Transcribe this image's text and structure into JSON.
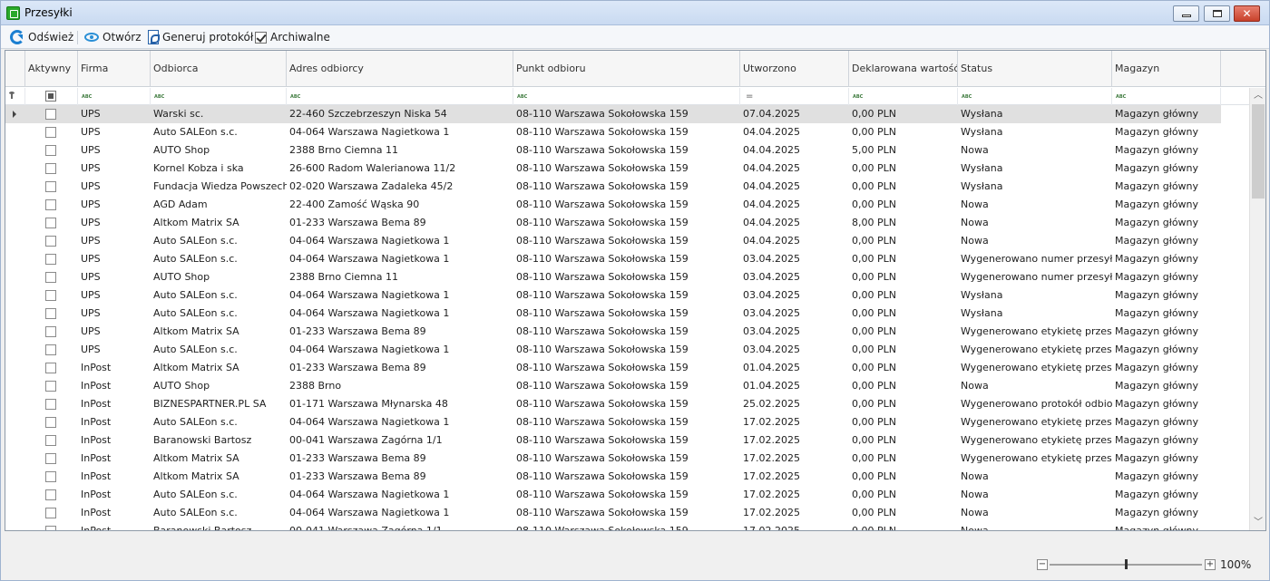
{
  "window": {
    "title": "Przesyłki"
  },
  "toolbar": {
    "refresh_label": "Odśwież",
    "open_label": "Otwórz",
    "protocol_label": "Generuj protokół",
    "archive_label": "Archiwalne",
    "archive_checked": true
  },
  "grid": {
    "columns": [
      "Aktywny",
      "Firma",
      "Odbiorca",
      "Adres odbiorcy",
      "Punkt odbioru",
      "Utworzono",
      "Deklarowana wartość",
      "Status",
      "Magazyn"
    ],
    "filter_types": [
      "check",
      "text",
      "text",
      "text",
      "text",
      "date",
      "text",
      "text",
      "text"
    ],
    "rows": [
      {
        "firma": "UPS",
        "odbiorca": "Warski sc.",
        "adres": "22-460 Szczebrzeszyn Niska 54",
        "punkt": "08-110 Warszawa Sokołowska 159",
        "utworzono": "07.04.2025",
        "wartosc": "0,00 PLN",
        "status": "Wysłana",
        "magazyn": "Magazyn główny",
        "selected": true
      },
      {
        "firma": "UPS",
        "odbiorca": "Auto SALEon s.c.",
        "adres": "04-064 Warszawa Nagietkowa 1",
        "punkt": "08-110 Warszawa Sokołowska 159",
        "utworzono": "04.04.2025",
        "wartosc": "0,00 PLN",
        "status": "Wysłana",
        "magazyn": "Magazyn główny"
      },
      {
        "firma": "UPS",
        "odbiorca": "AUTO Shop",
        "adres": "2388 Brno Ciemna 11",
        "punkt": "08-110 Warszawa Sokołowska 159",
        "utworzono": "04.04.2025",
        "wartosc": "5,00 PLN",
        "status": "Nowa",
        "magazyn": "Magazyn główny"
      },
      {
        "firma": "UPS",
        "odbiorca": "Kornel Kobza i ska",
        "adres": "26-600 Radom Walerianowa 11/2",
        "punkt": "08-110 Warszawa Sokołowska 159",
        "utworzono": "04.04.2025",
        "wartosc": "0,00 PLN",
        "status": "Wysłana",
        "magazyn": "Magazyn główny"
      },
      {
        "firma": "UPS",
        "odbiorca": "Fundacja Wiedza Powszech...",
        "adres": "02-020 Warszawa Zadaleka 45/2",
        "punkt": "08-110 Warszawa Sokołowska 159",
        "utworzono": "04.04.2025",
        "wartosc": "0,00 PLN",
        "status": "Wysłana",
        "magazyn": "Magazyn główny"
      },
      {
        "firma": "UPS",
        "odbiorca": "AGD Adam",
        "adres": "22-400 Zamość Wąska 90",
        "punkt": "08-110 Warszawa Sokołowska 159",
        "utworzono": "04.04.2025",
        "wartosc": "0,00 PLN",
        "status": "Nowa",
        "magazyn": "Magazyn główny"
      },
      {
        "firma": "UPS",
        "odbiorca": "Altkom Matrix SA",
        "adres": "01-233 Warszawa Bema 89",
        "punkt": "08-110 Warszawa Sokołowska 159",
        "utworzono": "04.04.2025",
        "wartosc": "8,00 PLN",
        "status": "Nowa",
        "magazyn": "Magazyn główny"
      },
      {
        "firma": "UPS",
        "odbiorca": "Auto SALEon s.c.",
        "adres": "04-064 Warszawa Nagietkowa 1",
        "punkt": "08-110 Warszawa Sokołowska 159",
        "utworzono": "04.04.2025",
        "wartosc": "0,00 PLN",
        "status": "Nowa",
        "magazyn": "Magazyn główny"
      },
      {
        "firma": "UPS",
        "odbiorca": "Auto SALEon s.c.",
        "adres": "04-064 Warszawa Nagietkowa 1",
        "punkt": "08-110 Warszawa Sokołowska 159",
        "utworzono": "03.04.2025",
        "wartosc": "0,00 PLN",
        "status": "Wygenerowano numer przesyłki",
        "magazyn": "Magazyn główny"
      },
      {
        "firma": "UPS",
        "odbiorca": "AUTO Shop",
        "adres": "2388 Brno Ciemna 11",
        "punkt": "08-110 Warszawa Sokołowska 159",
        "utworzono": "03.04.2025",
        "wartosc": "0,00 PLN",
        "status": "Wygenerowano numer przesyłki",
        "magazyn": "Magazyn główny"
      },
      {
        "firma": "UPS",
        "odbiorca": "Auto SALEon s.c.",
        "adres": "04-064 Warszawa Nagietkowa 1",
        "punkt": "08-110 Warszawa Sokołowska 159",
        "utworzono": "03.04.2025",
        "wartosc": "0,00 PLN",
        "status": "Wysłana",
        "magazyn": "Magazyn główny"
      },
      {
        "firma": "UPS",
        "odbiorca": "Auto SALEon s.c.",
        "adres": "04-064 Warszawa Nagietkowa 1",
        "punkt": "08-110 Warszawa Sokołowska 159",
        "utworzono": "03.04.2025",
        "wartosc": "0,00 PLN",
        "status": "Wysłana",
        "magazyn": "Magazyn główny"
      },
      {
        "firma": "UPS",
        "odbiorca": "Altkom Matrix SA",
        "adres": "01-233 Warszawa Bema 89",
        "punkt": "08-110 Warszawa Sokołowska 159",
        "utworzono": "03.04.2025",
        "wartosc": "0,00 PLN",
        "status": "Wygenerowano etykietę przesyłki",
        "magazyn": "Magazyn główny"
      },
      {
        "firma": "UPS",
        "odbiorca": "Auto SALEon s.c.",
        "adres": "04-064 Warszawa Nagietkowa 1",
        "punkt": "08-110 Warszawa Sokołowska 159",
        "utworzono": "03.04.2025",
        "wartosc": "0,00 PLN",
        "status": "Wygenerowano etykietę przesyłki",
        "magazyn": "Magazyn główny"
      },
      {
        "firma": "InPost",
        "odbiorca": "Altkom Matrix SA",
        "adres": "01-233 Warszawa Bema 89",
        "punkt": "08-110 Warszawa Sokołowska 159",
        "utworzono": "01.04.2025",
        "wartosc": "0,00 PLN",
        "status": "Wygenerowano etykietę przesyłki",
        "magazyn": "Magazyn główny"
      },
      {
        "firma": "InPost",
        "odbiorca": "AUTO Shop",
        "adres": "2388 Brno",
        "punkt": "08-110 Warszawa Sokołowska 159",
        "utworzono": "01.04.2025",
        "wartosc": "0,00 PLN",
        "status": "Nowa",
        "magazyn": "Magazyn główny"
      },
      {
        "firma": "InPost",
        "odbiorca": "BIZNESPARTNER.PL SA",
        "adres": "01-171 Warszawa Młynarska 48",
        "punkt": "08-110 Warszawa Sokołowska 159",
        "utworzono": "25.02.2025",
        "wartosc": "0,00 PLN",
        "status": "Wygenerowano protokół odbioru",
        "magazyn": "Magazyn główny"
      },
      {
        "firma": "InPost",
        "odbiorca": "Auto SALEon s.c.",
        "adres": "04-064 Warszawa Nagietkowa 1",
        "punkt": "08-110 Warszawa Sokołowska 159",
        "utworzono": "17.02.2025",
        "wartosc": "0,00 PLN",
        "status": "Wygenerowano etykietę przesyłki",
        "magazyn": "Magazyn główny"
      },
      {
        "firma": "InPost",
        "odbiorca": "Baranowski Bartosz",
        "adres": "00-041 Warszawa Zagórna 1/1",
        "punkt": "08-110 Warszawa Sokołowska 159",
        "utworzono": "17.02.2025",
        "wartosc": "0,00 PLN",
        "status": "Wygenerowano etykietę przesyłki",
        "magazyn": "Magazyn główny"
      },
      {
        "firma": "InPost",
        "odbiorca": "Altkom Matrix SA",
        "adres": "01-233 Warszawa Bema 89",
        "punkt": "08-110 Warszawa Sokołowska 159",
        "utworzono": "17.02.2025",
        "wartosc": "0,00 PLN",
        "status": "Wygenerowano etykietę przesyłki",
        "magazyn": "Magazyn główny"
      },
      {
        "firma": "InPost",
        "odbiorca": "Altkom Matrix SA",
        "adres": "01-233 Warszawa Bema 89",
        "punkt": "08-110 Warszawa Sokołowska 159",
        "utworzono": "17.02.2025",
        "wartosc": "0,00 PLN",
        "status": "Nowa",
        "magazyn": "Magazyn główny"
      },
      {
        "firma": "InPost",
        "odbiorca": "Auto SALEon s.c.",
        "adres": "04-064 Warszawa Nagietkowa 1",
        "punkt": "08-110 Warszawa Sokołowska 159",
        "utworzono": "17.02.2025",
        "wartosc": "0,00 PLN",
        "status": "Nowa",
        "magazyn": "Magazyn główny"
      },
      {
        "firma": "InPost",
        "odbiorca": "Auto SALEon s.c.",
        "adres": "04-064 Warszawa Nagietkowa 1",
        "punkt": "08-110 Warszawa Sokołowska 159",
        "utworzono": "17.02.2025",
        "wartosc": "0,00 PLN",
        "status": "Nowa",
        "magazyn": "Magazyn główny"
      },
      {
        "firma": "InPost",
        "odbiorca": "Baranowski Bartosz",
        "adres": "00-041 Warszawa Zagórna 1/1",
        "punkt": "08-110 Warszawa Sokołowska 159",
        "utworzono": "17.02.2025",
        "wartosc": "0,00 PLN",
        "status": "Nowa",
        "magazyn": "Magazyn główny"
      }
    ]
  },
  "zoom": {
    "minus": "−",
    "plus": "+",
    "label": "100%",
    "level": 0.5
  },
  "icons": {
    "app": "app-icon",
    "refresh": "refresh-icon",
    "open": "eye-icon",
    "protocol": "pdf-icon",
    "filter_text": "abc-filter-icon",
    "filter_date": "equals-filter-icon"
  },
  "colors": {
    "accent": "#1b7fd1",
    "selected_row": "#e0e0e0",
    "titlebar": "#c9daf1"
  }
}
